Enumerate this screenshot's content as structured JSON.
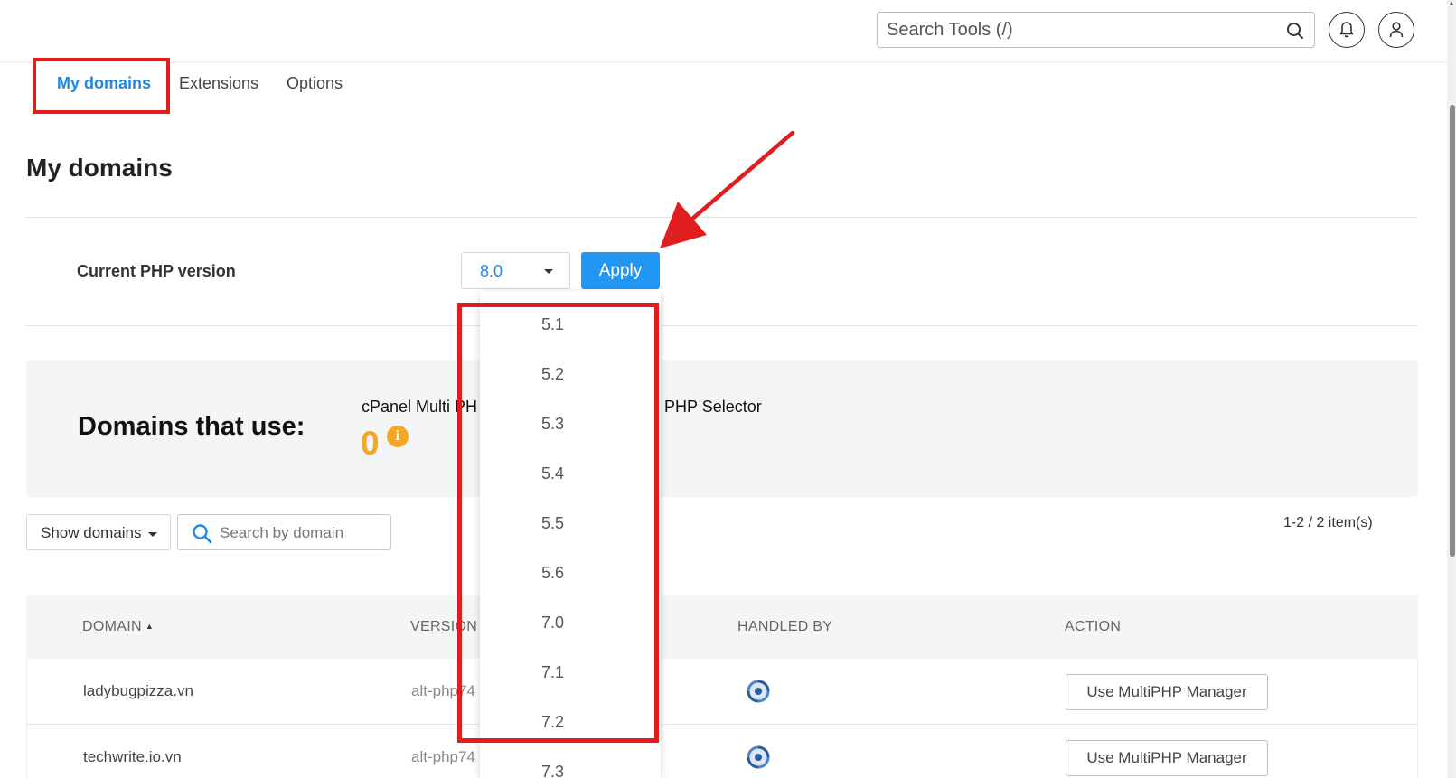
{
  "header": {
    "search_placeholder": "Search Tools (/)"
  },
  "tabs": [
    {
      "label": "My domains",
      "active": true
    },
    {
      "label": "Extensions"
    },
    {
      "label": "Options"
    }
  ],
  "page_title": "My domains",
  "php": {
    "label": "Current PHP version",
    "selected": "8.0",
    "apply_label": "Apply",
    "options": [
      "5.1",
      "5.2",
      "5.3",
      "5.4",
      "5.5",
      "5.6",
      "7.0",
      "7.1",
      "7.2",
      "7.3"
    ]
  },
  "domains_use": {
    "title": "Domains that use:",
    "cpanel_label": "cPanel Multi PH",
    "cloudlinux_label": "x PHP Selector",
    "count": "0",
    "info_glyph": "i"
  },
  "filters": {
    "show_domains_label": "Show domains",
    "search_placeholder": "Search by domain",
    "pager_text": "1-2 / 2 item(s)"
  },
  "table": {
    "headers": {
      "domain": "DOMAIN",
      "sort_glyph": "▲",
      "version": "VERSION",
      "handled_by": "HANDLED BY",
      "action": "ACTION"
    },
    "rows": [
      {
        "domain": "ladybugpizza.vn",
        "version": "alt-php74",
        "handler_icon": "cloudlinux-swirl-icon",
        "action": "Use MultiPHP Manager"
      },
      {
        "domain": "techwrite.io.vn",
        "version": "alt-php74",
        "handler_icon": "cloudlinux-swirl-icon",
        "action": "Use MultiPHP Manager"
      }
    ]
  },
  "colors": {
    "accent": "#2196f3",
    "active_tab": "#1e88e5",
    "highlight": "#e01e1e",
    "count": "#f5a623"
  }
}
